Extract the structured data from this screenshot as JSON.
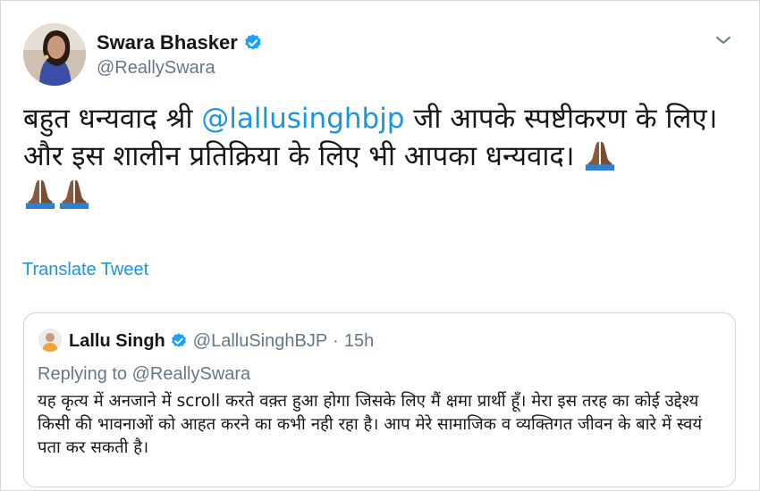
{
  "tweet": {
    "author_name": "Swara Bhasker",
    "author_handle": "@ReallySwara",
    "text_before_mention": "बहुत धन्यवाद श्री ",
    "mention": "@lallusinghbjp",
    "text_after_mention": " जी आपके स्पष्टीकरण के लिए। और इस शालीन प्रतिक्रिया के लिए भी आपका धन्यवाद। ",
    "emojis": [
      "folded-hands-icon",
      "folded-hands-icon",
      "folded-hands-icon"
    ],
    "translate_label": "Translate Tweet"
  },
  "quoted_tweet": {
    "author_name": "Lallu Singh",
    "author_handle": "@LalluSinghBJP",
    "separator": "·",
    "time": "15h",
    "replying_to": "Replying to @ReallySwara",
    "text": "यह कृत्य में अनजाने में scroll करते वक़्त हुआ होगा जिसके लिए मैं क्षमा प्रार्थी हूँ। मेरा इस तरह का कोई उद्देश्य किसी की भावनाओं को आहत करने का कभी नही रहा है। आप मेरे सामाजिक व व्यक्तिगत जीवन के बारे में स्वयं पता कर सकती है।"
  },
  "colors": {
    "link": "#1b95e0",
    "secondary_text": "#657786",
    "verified_badge": "#1da1f2",
    "border": "#ccd6dd"
  },
  "icons": {
    "verified": "verified-badge-icon",
    "caret": "chevron-down-icon"
  }
}
